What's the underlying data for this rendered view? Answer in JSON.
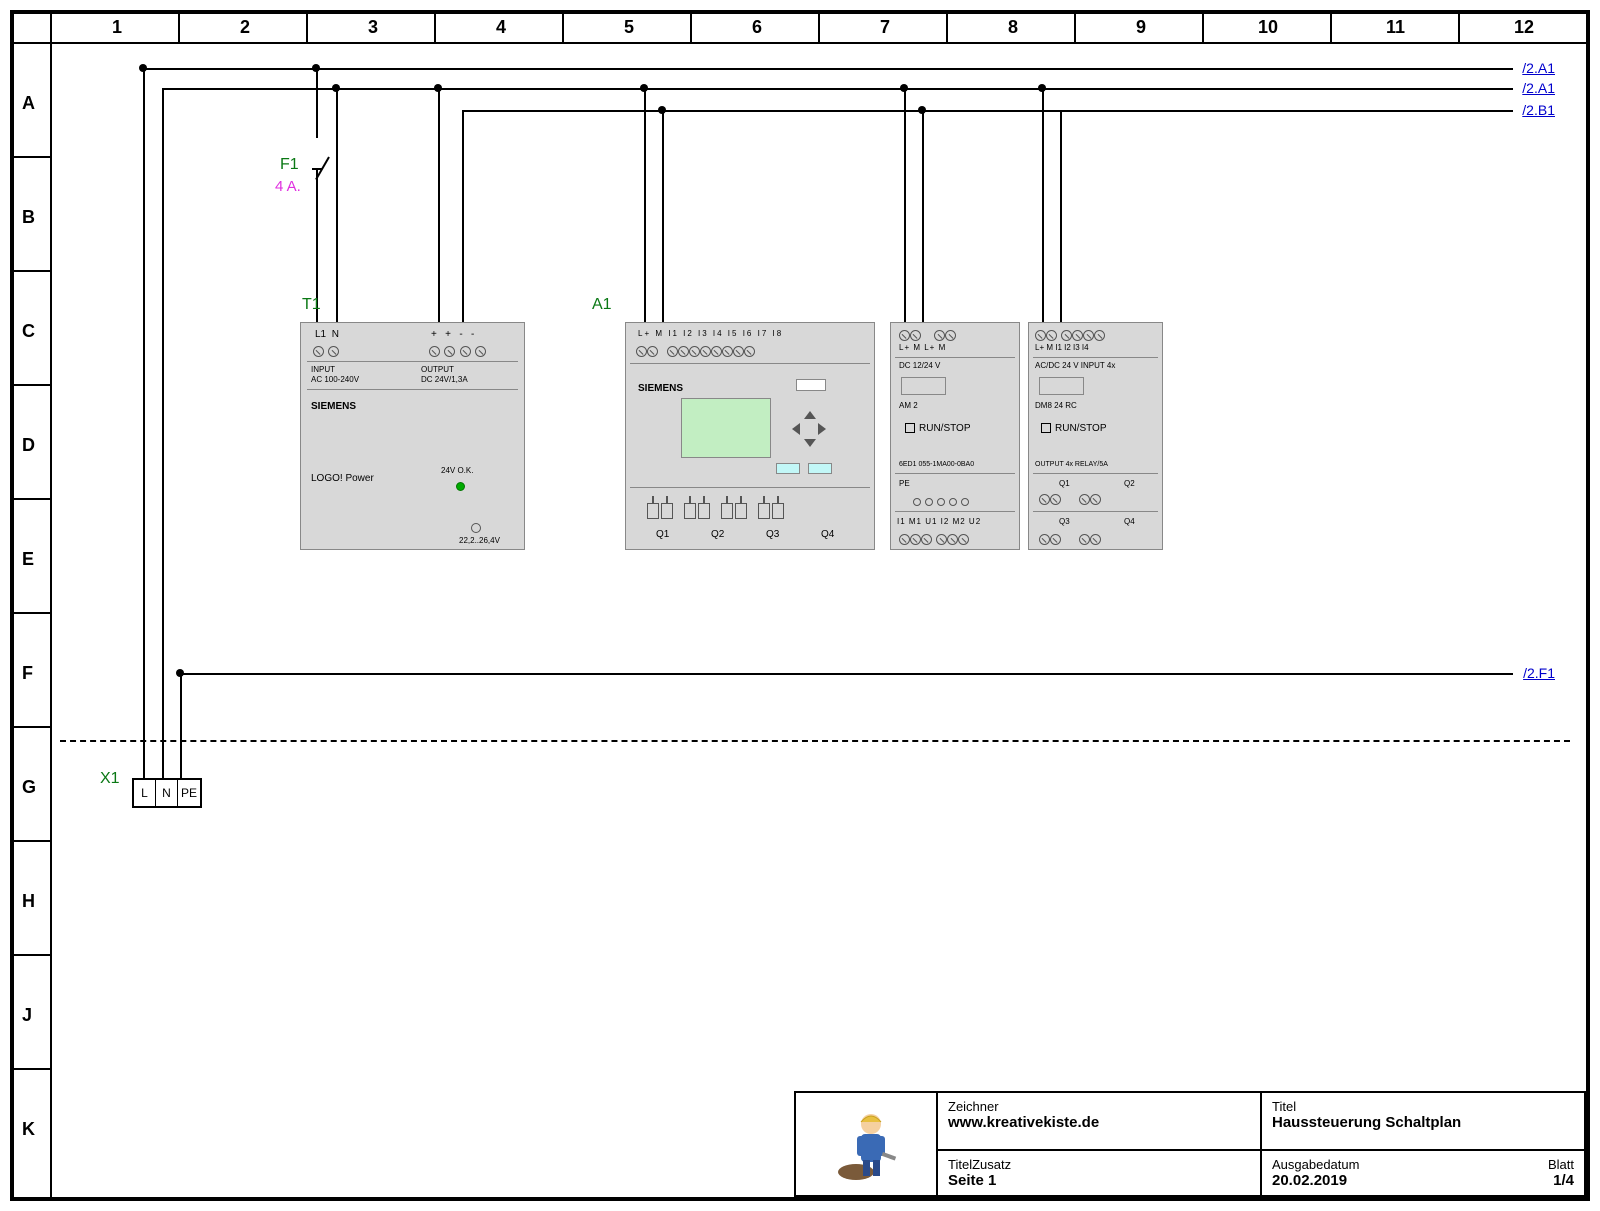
{
  "grid": {
    "cols": [
      "1",
      "2",
      "3",
      "4",
      "5",
      "6",
      "7",
      "8",
      "9",
      "10",
      "11",
      "12"
    ],
    "rows": [
      "A",
      "B",
      "C",
      "D",
      "E",
      "F",
      "G",
      "H",
      "J",
      "K"
    ]
  },
  "xrefs": {
    "a1_1": "/2.A1",
    "a1_2": "/2.A1",
    "b1": "/2.B1",
    "f1": "/2.F1"
  },
  "designators": {
    "f1": "F1",
    "f1_rating": "4 A.",
    "t1": "T1",
    "a1": "A1",
    "x1": "X1"
  },
  "terminals": {
    "l": "L",
    "n": "N",
    "pe": "PE"
  },
  "power_supply": {
    "brand": "SIEMENS",
    "model": "LOGO! Power",
    "led": "24V O.K.",
    "in_label": "INPUT",
    "in_range": "AC 100-240V",
    "out_label": "OUTPUT",
    "out_range": "DC 24V/1,3A",
    "range": "22,2..26,4V",
    "t_l1": "L1",
    "t_n": "N"
  },
  "plc": {
    "brand": "SIEMENS",
    "inputs": "L+  M    I1  I2  I3  I4  I5  I6  I7  I8",
    "outputs": {
      "q1": "Q1",
      "q2": "Q2",
      "q3": "Q3",
      "q4": "Q4"
    }
  },
  "am2": {
    "top": "L+  M        L+  M",
    "dc": "DC 12/24 V",
    "name": "AM 2",
    "run": "RUN/STOP",
    "order": "6ED1 055-1MA00-0BA0",
    "pe": "PE",
    "bottom": "I1  M1 U1  I2  M2 U2"
  },
  "dm8": {
    "top": "L+  M   I1   I2   I3   I4",
    "dc": "AC/DC 24 V   INPUT 4x",
    "name": "DM8 24 RC",
    "run": "RUN/STOP",
    "out": "OUTPUT 4x RELAY/5A",
    "q1": "Q1",
    "q2": "Q2",
    "q3": "Q3",
    "q4": "Q4"
  },
  "title_block": {
    "zeichner_label": "Zeichner",
    "zeichner": "www.kreativekiste.de",
    "titel_label": "Titel",
    "titel": "Haussteuerung Schaltplan",
    "zusatz_label": "TitelZusatz",
    "zusatz": "Seite 1",
    "datum_label": "Ausgabedatum",
    "datum": "20.02.2019",
    "blatt_label": "Blatt",
    "blatt": "1/4"
  }
}
